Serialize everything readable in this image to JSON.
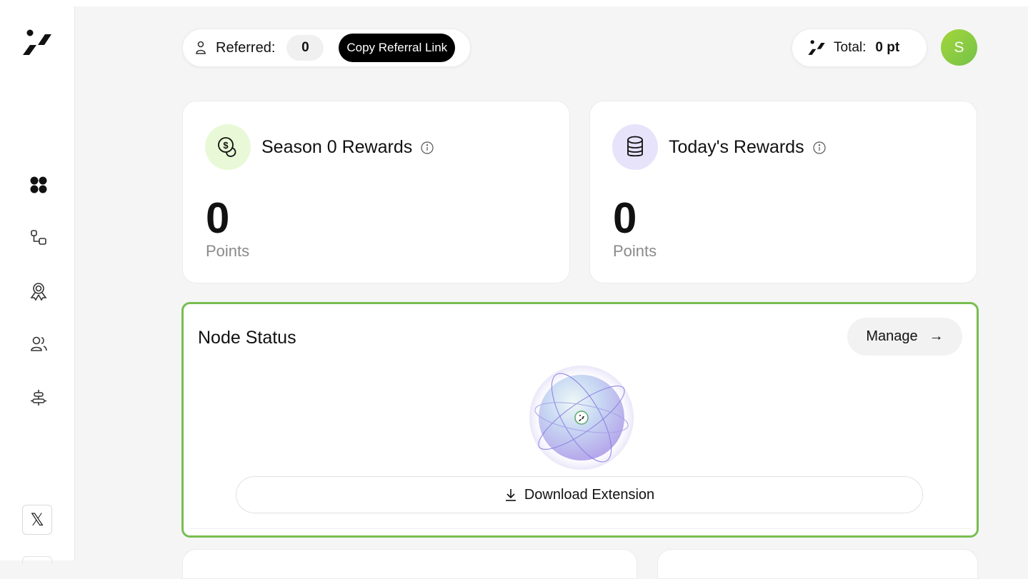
{
  "sidebar": {
    "logo": "app-logo",
    "nav_items": [
      {
        "name": "dashboard",
        "icon": "grid-icon"
      },
      {
        "name": "nodes",
        "icon": "nodes-icon"
      },
      {
        "name": "rewards",
        "icon": "badge-icon"
      },
      {
        "name": "referrals",
        "icon": "users-icon"
      },
      {
        "name": "settings",
        "icon": "sliders-icon"
      }
    ],
    "social": {
      "icon": "x-icon",
      "label": "𝕏"
    }
  },
  "header": {
    "referred_label": "Referred:",
    "referred_count": "0",
    "copy_referral_label": "Copy Referral Link",
    "total_label": "Total:",
    "total_value": "0 pt",
    "avatar_initial": "S"
  },
  "rewards": {
    "season": {
      "title": "Season 0 Rewards",
      "value": "0",
      "unit": "Points",
      "icon": "coins-icon"
    },
    "today": {
      "title": "Today's Rewards",
      "value": "0",
      "unit": "Points",
      "icon": "database-icon"
    }
  },
  "node_status": {
    "title": "Node Status",
    "manage_label": "Manage",
    "manage_arrow": "→",
    "download_label": "Download Extension"
  },
  "colors": {
    "accent_green": "#78bd50",
    "avatar_gradient_start": "#a4d63a",
    "avatar_gradient_end": "#74c24a",
    "season_icon_bg": "#e9f9d7",
    "today_icon_bg": "#e6e3fb"
  }
}
